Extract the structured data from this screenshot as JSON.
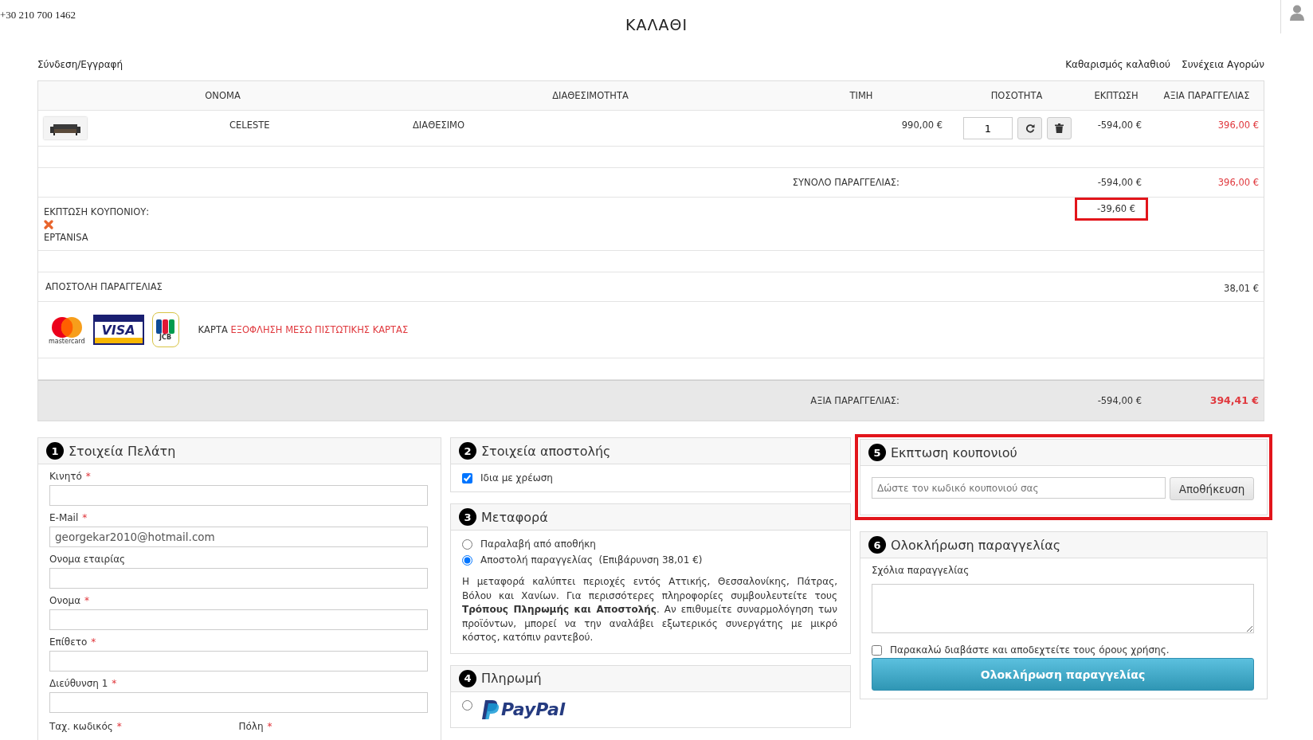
{
  "header": {
    "phone": "+30 210 700 1462",
    "title": "ΚΑΛΑΘΙ"
  },
  "links": {
    "login": "Σύνδεση/Εγγραφή",
    "actions": [
      "Καθαρισμός καλαθιού",
      "Συνέχεια Αγορών"
    ]
  },
  "cart": {
    "columns": [
      "ΟΝΟΜΑ",
      "ΔΙΑΘΕΣΙΜΟΤΗΤΑ",
      "ΤΙΜΗ",
      "ΠΟΣΟΤΗΤΑ",
      "ΕΚΠΤΩΣΗ",
      "ΑΞΙΑ ΠΑΡΑΓΓΕΛΙΑΣ"
    ],
    "items": [
      {
        "kind": "picture",
        "name": "CELESTE",
        "availability": "ΔΙΑΘΕΣΙΜΟ",
        "price": "990,00 €",
        "quantity": "1",
        "discount": "-594,00 €",
        "value": "396,00 €"
      }
    ],
    "subtotal": {
      "label": "ΣΥΝΟΛΟ ΠΑΡΑΓΓΕΛΙΑΣ:",
      "discount": "-594,00 €",
      "value": "396,00 €"
    },
    "coupon": {
      "label": "ΕΚΠΤΩΣΗ ΚΟΥΠΟΝΙΟΥ:",
      "code": "EPTANISA",
      "amount": "-39,60 €",
      "highlighted": true
    },
    "shipping": {
      "label": "ΑΠΟΣΤΟΛΗ ΠΑΡΑΓΓΕΛΙΑΣ",
      "value": "38,01 €"
    },
    "payment": {
      "logos": [
        {
          "kind": "mastercard",
          "label": "mastercard"
        },
        {
          "kind": "visa",
          "label": "VISA"
        },
        {
          "kind": "jcb",
          "label": "JCB"
        }
      ],
      "label": "ΚΑΡΤΑ",
      "method": "ΕΞΟΦΛΗΣΗ ΜΕΣΩ ΠΙΣΤΩΤΙΚΗΣ ΚΑΡΤΑΣ"
    },
    "total": {
      "label": "ΑΞΙΑ ΠΑΡΑΓΓΕΛΙΑΣ:",
      "discount": "-594,00 €",
      "value": "394,41 €"
    }
  },
  "customer": {
    "number": "1",
    "title": "Στοιχεία Πελάτη",
    "required_mark": "*",
    "fields": [
      {
        "label": "Κινητό",
        "required": true
      },
      {
        "label": "E-Mail",
        "required": true,
        "value": "georgekar2010@hotmail.com"
      },
      {
        "label": "Ονομα εταιρίας",
        "required": false
      },
      {
        "label": "Ονομα",
        "required": true
      },
      {
        "label": "Επίθετο",
        "required": true
      },
      {
        "label": "Διεύθυνση 1",
        "required": true
      }
    ],
    "half_fields": [
      {
        "label": "Ταχ. κωδικός",
        "required": true
      },
      {
        "label": "Πόλη",
        "required": true
      }
    ]
  },
  "shipping_details": {
    "number": "2",
    "title": "Στοιχεία αποστολής",
    "same_as_billing": {
      "label": "Ιδια με χρέωση",
      "checked": true
    }
  },
  "transport": {
    "number": "3",
    "title": "Μεταφορά",
    "options": [
      {
        "label": "Παραλαβή από αποθήκη",
        "selected": false
      },
      {
        "label": "Αποστολή παραγγελίας  (Επιβάρυνση 38,01 €)",
        "selected": true
      }
    ],
    "note": "Η μεταφορά καλύπτει περιοχές εντός Αττικής, Θεσσαλονίκης, Πάτρας, Βόλου και Χανίων. Για περισσότερες πληροφορίες συμβουλευτείτε τους **Τρόπους Πληρωμής και Αποστολής**. Αν επιθυμείτε συναρμολόγηση των προϊόντων, μπορεί να την αναλάβει εξωτερικός συνεργάτης με μικρό κόστος, κατόπιν ραντεβού."
  },
  "payment_method": {
    "number": "4",
    "title": "Πληρωμή",
    "options": [
      {
        "label": "PayPal",
        "selected": false
      }
    ]
  },
  "coupon_panel": {
    "number": "5",
    "title": "Εκπτωση κουπονιού",
    "highlighted": true,
    "placeholder": "Δώστε τον κωδικό κουπονιού σας",
    "button": "Αποθήκευση"
  },
  "checkout": {
    "number": "6",
    "title": "Ολοκλήρωση παραγγελίας",
    "comments_label": "Σχόλια παραγγελίας",
    "terms": {
      "label": "Παρακαλώ διαβάστε και αποδεχτείτε τους όρους χρήσης.",
      "checked": false
    },
    "button": "Ολοκλήρωση παραγγελίας"
  }
}
